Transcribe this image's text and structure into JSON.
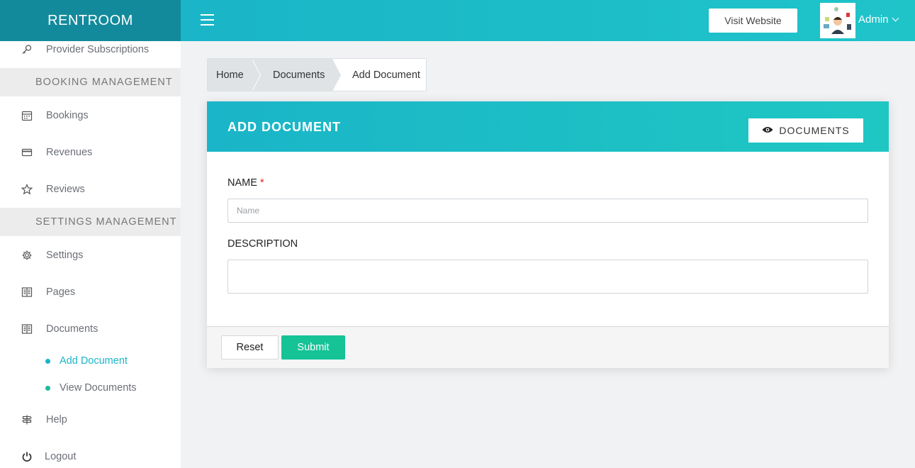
{
  "brand": "RENTROOM",
  "header": {
    "visit_website": "Visit Website",
    "user_name": "Admin"
  },
  "sidebar": {
    "items_top": [
      {
        "label": "Provider Subscriptions",
        "icon": "key-icon"
      }
    ],
    "sections": {
      "booking": "BOOKING MANAGEMENT",
      "settings": "SETTINGS MANAGEMENT"
    },
    "booking_items": [
      {
        "label": "Bookings",
        "icon": "calendar-icon"
      },
      {
        "label": "Revenues",
        "icon": "credit-card-icon"
      },
      {
        "label": "Reviews",
        "icon": "star-icon"
      }
    ],
    "settings_items": [
      {
        "label": "Settings",
        "icon": "gear-icon"
      },
      {
        "label": "Pages",
        "icon": "book-icon"
      },
      {
        "label": "Documents",
        "icon": "book-icon"
      }
    ],
    "documents_sub": [
      {
        "label": "Add Document",
        "active": true
      },
      {
        "label": "View Documents",
        "active": false
      }
    ],
    "items_bottom": [
      {
        "label": "Help",
        "icon": "signpost-icon"
      },
      {
        "label": "Logout",
        "icon": "power-icon"
      }
    ]
  },
  "breadcrumb": [
    "Home",
    "Documents",
    "Add Document"
  ],
  "card": {
    "title": "ADD DOCUMENT",
    "documents_button": "DOCUMENTS",
    "name_label": "NAME",
    "required_mark": "*",
    "name_placeholder": "Name",
    "name_value": "",
    "description_label": "DESCRIPTION",
    "description_value": "",
    "reset": "Reset",
    "submit": "Submit"
  },
  "colors": {
    "brand_bg": "#138a9c",
    "accent": "#1ab5c8",
    "submit": "#15c397",
    "active_dot": "#1ab5c8",
    "inactive_dot": "#1fb8a0"
  }
}
